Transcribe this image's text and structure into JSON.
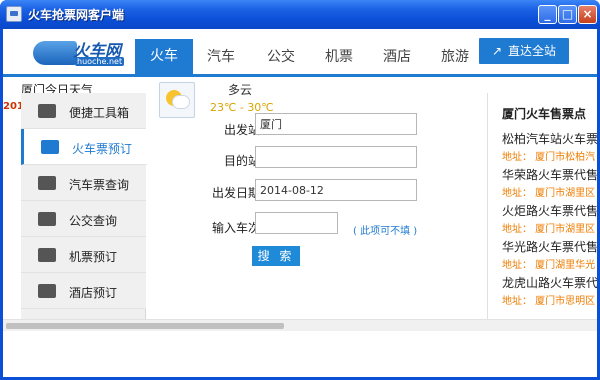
{
  "window": {
    "title": "火车抢票网客户端",
    "min_label": "_",
    "max_label": "□",
    "close_label": "×"
  },
  "logo": {
    "text": "火车网",
    "sub": "huoche.net"
  },
  "nav": {
    "tabs": [
      {
        "label": "火车",
        "active": true
      },
      {
        "label": "汽车"
      },
      {
        "label": "公交"
      },
      {
        "label": "机票"
      },
      {
        "label": "酒店"
      },
      {
        "label": "旅游"
      }
    ],
    "direct_label": "直达全站",
    "direct_icon": "↗"
  },
  "weather": {
    "city_label": "厦门今日天气",
    "condition": "多云",
    "temp": "23℃ - 30℃",
    "year_clip": "201"
  },
  "sidebar": {
    "items": [
      {
        "label": "便捷工具箱",
        "icon": "toolbox-icon"
      },
      {
        "label": "火车票预订",
        "icon": "train-icon",
        "active": true
      },
      {
        "label": "汽车票查询",
        "icon": "bus-icon"
      },
      {
        "label": "公交查询",
        "icon": "transit-bus-icon"
      },
      {
        "label": "机票预订",
        "icon": "airplane-icon"
      },
      {
        "label": "酒店预订",
        "icon": "hotel-icon"
      }
    ]
  },
  "form": {
    "from_label": "出发站:",
    "from_value": "厦门",
    "to_label": "目的站:",
    "to_value": "",
    "date_label": "出发日期:",
    "date_value": "2014-08-12",
    "train_label": "输入车次:",
    "train_value": "",
    "hint": "( 此项可不填 )",
    "search_label": "搜 索"
  },
  "sale_points": {
    "title": "厦门火车售票点",
    "items": [
      {
        "name": "松柏汽车站火车票代售",
        "addr": "地址： 厦门市松柏汽"
      },
      {
        "name": "华荣路火车票代售点",
        "addr": "地址： 厦门市湖里区"
      },
      {
        "name": "火炬路火车票代售点",
        "addr": "地址： 厦门市湖里区"
      },
      {
        "name": "华光路火车票代售点",
        "addr": "地址： 厦门湖里华光"
      },
      {
        "name": "龙虎山路火车票代售",
        "addr": "地址： 厦门市思明区"
      }
    ]
  },
  "colors": {
    "accent": "#1f7ad1",
    "address": "#ef7d00",
    "titlebar": "#0a4fd6"
  }
}
